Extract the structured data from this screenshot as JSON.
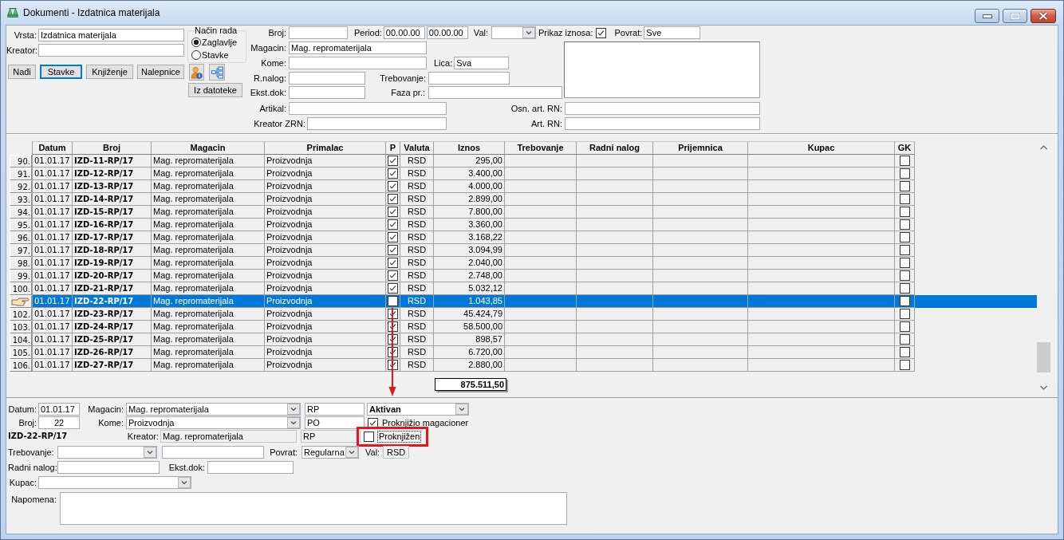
{
  "window": {
    "title": "Dokumenti - Izdatnica materijala"
  },
  "filter": {
    "vrsta": {
      "label": "Vrsta:",
      "value": "Izdatnica materijala"
    },
    "kreator": {
      "label": "Kreator:"
    },
    "buttons": [
      {
        "label": "Nađi",
        "focused": false
      },
      {
        "label": "Stavke",
        "focused": true
      },
      {
        "label": "Knjiženje",
        "focused": false
      },
      {
        "label": "Nalepnice",
        "focused": false
      }
    ],
    "mode": {
      "title": "Način rada",
      "options": [
        {
          "label": "Zaglavlje",
          "selected": true
        },
        {
          "label": "Stavke",
          "selected": false
        }
      ]
    },
    "import_button": "Iz datoteke",
    "broj": {
      "label": "Broj:"
    },
    "period": {
      "label": "Period:",
      "from": "00.00.00",
      "to": "00.00.00"
    },
    "val": {
      "label": "Val:"
    },
    "prikaz_iznosa": {
      "label": "Prikaz iznosa:",
      "checked": true
    },
    "povrat": {
      "label": "Povrat:",
      "value": "Sve"
    },
    "magacin": {
      "label": "Magacin:",
      "value": "Mag. repromaterijala"
    },
    "kome": {
      "label": "Kome:"
    },
    "lica": {
      "label": "Lica:",
      "value": "Sva"
    },
    "r_nalog": {
      "label": "R.nalog:"
    },
    "trebovanje": {
      "label": "Trebovanje:"
    },
    "ekst_dok": {
      "label": "Ekst.dok:"
    },
    "faza": {
      "label": "Faza pr.:"
    },
    "artikal": {
      "label": "Artikal:"
    },
    "osn_art_rn": {
      "label": "Osn. art. RN:"
    },
    "kreator_zrn": {
      "label": "Kreator ZRN:"
    },
    "art_rn": {
      "label": "Art. RN:"
    }
  },
  "table": {
    "columns": [
      "Datum",
      "Broj",
      "Magacin",
      "Primalac",
      "P",
      "Valuta",
      "Iznos",
      "Trebovanje",
      "Radni nalog",
      "Prijemnica",
      "Kupac",
      "GK"
    ],
    "rows": [
      {
        "number": "90.",
        "datum": "01.01.17",
        "broj": "IZD-11-RP/17",
        "magacin": "Mag. repromaterijala",
        "primalac": "Proizvodnja",
        "p": true,
        "valuta": "RSD",
        "iznos": "295,00",
        "gk": false,
        "selected": false
      },
      {
        "number": "91.",
        "datum": "01.01.17",
        "broj": "IZD-12-RP/17",
        "magacin": "Mag. repromaterijala",
        "primalac": "Proizvodnja",
        "p": true,
        "valuta": "RSD",
        "iznos": "3.400,00",
        "gk": false,
        "selected": false
      },
      {
        "number": "92.",
        "datum": "01.01.17",
        "broj": "IZD-13-RP/17",
        "magacin": "Mag. repromaterijala",
        "primalac": "Proizvodnja",
        "p": true,
        "valuta": "RSD",
        "iznos": "4.000,00",
        "gk": false,
        "selected": false
      },
      {
        "number": "93.",
        "datum": "01.01.17",
        "broj": "IZD-14-RP/17",
        "magacin": "Mag. repromaterijala",
        "primalac": "Proizvodnja",
        "p": true,
        "valuta": "RSD",
        "iznos": "2.899,00",
        "gk": false,
        "selected": false
      },
      {
        "number": "94.",
        "datum": "01.01.17",
        "broj": "IZD-15-RP/17",
        "magacin": "Mag. repromaterijala",
        "primalac": "Proizvodnja",
        "p": true,
        "valuta": "RSD",
        "iznos": "7.800,00",
        "gk": false,
        "selected": false
      },
      {
        "number": "95.",
        "datum": "01.01.17",
        "broj": "IZD-16-RP/17",
        "magacin": "Mag. repromaterijala",
        "primalac": "Proizvodnja",
        "p": true,
        "valuta": "RSD",
        "iznos": "3.360,00",
        "gk": false,
        "selected": false
      },
      {
        "number": "96.",
        "datum": "01.01.17",
        "broj": "IZD-17-RP/17",
        "magacin": "Mag. repromaterijala",
        "primalac": "Proizvodnja",
        "p": true,
        "valuta": "RSD",
        "iznos": "3.168,22",
        "gk": false,
        "selected": false
      },
      {
        "number": "97.",
        "datum": "01.01.17",
        "broj": "IZD-18-RP/17",
        "magacin": "Mag. repromaterijala",
        "primalac": "Proizvodnja",
        "p": true,
        "valuta": "RSD",
        "iznos": "3.094,99",
        "gk": false,
        "selected": false
      },
      {
        "number": "98.",
        "datum": "01.01.17",
        "broj": "IZD-19-RP/17",
        "magacin": "Mag. repromaterijala",
        "primalac": "Proizvodnja",
        "p": true,
        "valuta": "RSD",
        "iznos": "2.040,00",
        "gk": false,
        "selected": false
      },
      {
        "number": "99.",
        "datum": "01.01.17",
        "broj": "IZD-20-RP/17",
        "magacin": "Mag. repromaterijala",
        "primalac": "Proizvodnja",
        "p": true,
        "valuta": "RSD",
        "iznos": "2.748,00",
        "gk": false,
        "selected": false
      },
      {
        "number": "100.",
        "datum": "01.01.17",
        "broj": "IZD-21-RP/17",
        "magacin": "Mag. repromaterijala",
        "primalac": "Proizvodnja",
        "p": true,
        "valuta": "RSD",
        "iznos": "5.032,12",
        "gk": false,
        "selected": false
      },
      {
        "datum": "01.01.17",
        "broj": "IZD-22-RP/17",
        "magacin": "Mag. repromaterijala",
        "primalac": "Proizvodnja",
        "p": false,
        "valuta": "RSD",
        "iznos": "1.043,85",
        "gk": false,
        "selected": true
      },
      {
        "number": "102.",
        "datum": "01.01.17",
        "broj": "IZD-23-RP/17",
        "magacin": "Mag. repromaterijala",
        "primalac": "Proizvodnja",
        "p": true,
        "valuta": "RSD",
        "iznos": "45.424,79",
        "gk": false,
        "selected": false
      },
      {
        "number": "103.",
        "datum": "01.01.17",
        "broj": "IZD-24-RP/17",
        "magacin": "Mag. repromaterijala",
        "primalac": "Proizvodnja",
        "p": true,
        "valuta": "RSD",
        "iznos": "58.500,00",
        "gk": false,
        "selected": false
      },
      {
        "number": "104.",
        "datum": "01.01.17",
        "broj": "IZD-25-RP/17",
        "magacin": "Mag. repromaterijala",
        "primalac": "Proizvodnja",
        "p": true,
        "valuta": "RSD",
        "iznos": "898,57",
        "gk": false,
        "selected": false
      },
      {
        "number": "105.",
        "datum": "01.01.17",
        "broj": "IZD-26-RP/17",
        "magacin": "Mag. repromaterijala",
        "primalac": "Proizvodnja",
        "p": true,
        "valuta": "RSD",
        "iznos": "6.720,00",
        "gk": false,
        "selected": false
      },
      {
        "number": "106.",
        "datum": "01.01.17",
        "broj": "IZD-27-RP/17",
        "magacin": "Mag. repromaterijala",
        "primalac": "Proizvodnja",
        "p": true,
        "valuta": "RSD",
        "iznos": "2.880,00",
        "gk": false,
        "selected": false
      }
    ],
    "total": "875.511,50"
  },
  "detail": {
    "datum": {
      "label": "Datum:",
      "value": "01.01.17"
    },
    "magacin": {
      "label": "Magacin:",
      "value": "Mag. repromaterijala",
      "code": "RP"
    },
    "status": {
      "value": "Aktivan"
    },
    "broj": {
      "label": "Broj:",
      "value": "22"
    },
    "kome": {
      "label": "Kome:",
      "value": "Proizvodnja",
      "code": "PO"
    },
    "proknjizio_magacioner": {
      "label": "Proknjižio magacioner",
      "checked": true
    },
    "document": "IZD-22-RP/17",
    "kreator": {
      "label": "Kreator:",
      "value": "Mag. repromaterijala",
      "code": "RP"
    },
    "proknjizen": {
      "label": "Proknjižen",
      "checked": false
    },
    "trebovanje": {
      "label": "Trebovanje:"
    },
    "povrat": {
      "label": "Povrat:",
      "value": "Regularna"
    },
    "val": {
      "label": "Val:",
      "value": "RSD"
    },
    "radni_nalog": {
      "label": "Radni nalog:"
    },
    "ekst_dok": {
      "label": "Ekst.dok:"
    },
    "kupac": {
      "label": "Kupac:"
    },
    "napomena": {
      "label": "Napomena:"
    }
  }
}
